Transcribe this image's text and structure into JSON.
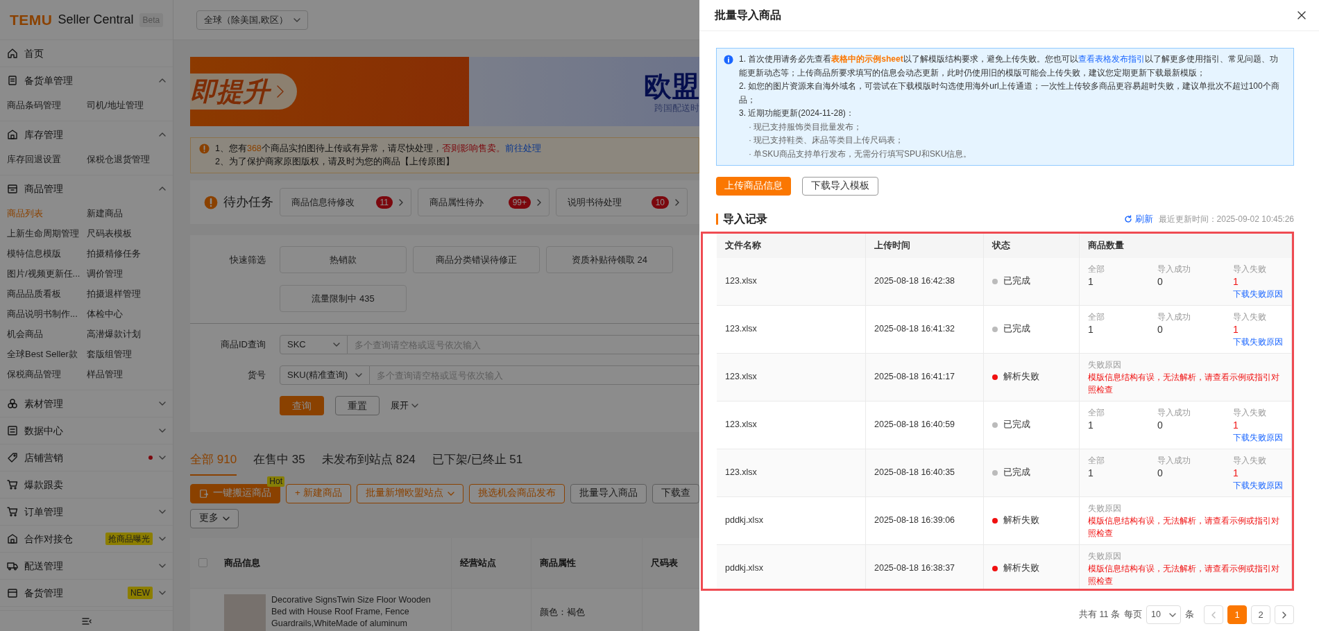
{
  "header": {
    "logo": "TEMU",
    "title": "Seller Central",
    "tag": "Beta",
    "region": "全球（除美国,欧区）"
  },
  "sidebar": {
    "items": [
      {
        "kind": "link",
        "label": "首页",
        "notice": false
      },
      {
        "kind": "group",
        "label": "备货单管理",
        "expanded": true,
        "notice": false,
        "children": [
          {
            "label": "商品条码管理",
            "selected": false
          },
          {
            "label": "司机/地址管理",
            "selected": false
          }
        ]
      },
      {
        "kind": "group",
        "label": "库存管理",
        "expanded": true,
        "notice": false,
        "children": [
          {
            "label": "库存回退设置",
            "selected": false
          },
          {
            "label": "保税仓退货管理",
            "selected": false
          }
        ]
      },
      {
        "kind": "group",
        "label": "商品管理",
        "expanded": true,
        "notice": false,
        "children": [
          {
            "label": "商品列表",
            "selected": true
          },
          {
            "label": "新建商品",
            "selected": false
          },
          {
            "label": "上新生命周期管理",
            "selected": false
          },
          {
            "label": "尺码表模板",
            "selected": false
          },
          {
            "label": "模特信息模版",
            "selected": false
          },
          {
            "label": "拍摄精修任务",
            "selected": false
          },
          {
            "label": "图片/视频更新任...",
            "selected": false
          },
          {
            "label": "调价管理",
            "selected": false
          },
          {
            "label": "商品品质看板",
            "selected": false
          },
          {
            "label": "拍摄退样管理",
            "selected": false
          },
          {
            "label": "商品说明书制作...",
            "selected": false
          },
          {
            "label": "体检中心",
            "selected": false
          },
          {
            "label": "机会商品",
            "selected": false
          },
          {
            "label": "高潜爆款计划",
            "selected": false
          },
          {
            "label": "全球Best Seller款",
            "selected": false
          },
          {
            "label": "套版组管理",
            "selected": false
          },
          {
            "label": "保税商品管理",
            "selected": false
          },
          {
            "label": "样品管理",
            "selected": false
          }
        ]
      },
      {
        "kind": "group",
        "label": "素材管理",
        "expanded": false,
        "notice": false
      },
      {
        "kind": "group",
        "label": "数据中心",
        "expanded": false,
        "notice": false
      },
      {
        "kind": "group",
        "label": "店铺营销",
        "expanded": false,
        "notice": true
      },
      {
        "kind": "link",
        "label": "爆款跟卖",
        "notice": false
      },
      {
        "kind": "group",
        "label": "订单管理",
        "expanded": false,
        "notice": false
      },
      {
        "kind": "group",
        "label": "合作对接仓",
        "expanded": false,
        "notice": false,
        "tag": "抢商品曝光"
      },
      {
        "kind": "group",
        "label": "配送管理",
        "expanded": false,
        "notice": false
      },
      {
        "kind": "group",
        "label": "备货管理",
        "expanded": false,
        "notice": false,
        "tag": "NEW"
      }
    ]
  },
  "main": {
    "banner": {
      "promo_text": "即提升",
      "eu_title": "欧盟",
      "eu_subtitle": "跨国配送时"
    },
    "notice": {
      "prefix": "1、您有",
      "count": "368",
      "middle": "个商品实拍图待上传或有异常，请尽快处理，",
      "warning": "否则影响售卖。",
      "link": "前往处理",
      "line2": "2、为了保护商家原图版权，请及时为您的商品【上传原图】"
    },
    "todo": {
      "title": "待办任务",
      "items": [
        {
          "label": "商品信息待修改",
          "count": "11"
        },
        {
          "label": "商品属性待办",
          "count": "99+"
        },
        {
          "label": "说明书待处理",
          "count": "10"
        }
      ]
    },
    "quick_filter": {
      "label": "快速筛选",
      "chips": [
        "热销款",
        "商品分类错误待修正",
        "资质补贴待领取 24",
        "流量限制中 435"
      ]
    },
    "search": {
      "fields": [
        {
          "label": "商品ID查询",
          "select": "SKC",
          "placeholder": "多个查询请空格或逗号依次输入"
        },
        {
          "label": "货号",
          "select": "SKU(精准查询)",
          "placeholder": "多个查询请空格或逗号依次输入"
        }
      ],
      "query_button": "查询",
      "reset_button": "重置",
      "expand_link": "展开"
    },
    "status_tabs": [
      {
        "label": "全部 910",
        "selected": true
      },
      {
        "label": "在售中 35",
        "selected": false
      },
      {
        "label": "未发布到站点 824",
        "selected": false
      },
      {
        "label": "已下架/已终止 51",
        "selected": false
      }
    ],
    "toolbar": {
      "buttons": [
        {
          "kind": "primary",
          "label": "一键搬运商品",
          "tag": "Hot"
        },
        {
          "kind": "accent",
          "label": "+ 新建商品"
        },
        {
          "kind": "accent-menu",
          "label": "批量新增欧盟站点"
        },
        {
          "kind": "accent",
          "label": "挑选机会商品发布"
        },
        {
          "kind": "plain",
          "label": "批量导入商品"
        },
        {
          "kind": "plain",
          "label": "下载查"
        }
      ],
      "more": "更多"
    },
    "product_table": {
      "select_all_checked": false,
      "columns": [
        "商品信息",
        "经营站点",
        "商品属性",
        "尺码表"
      ],
      "rows": [
        {
          "title": "Decorative SignsTwin Size Floor Wooden Bed with House Roof Frame, Fence Guardrails,WhiteMade of aluminum",
          "attribute": "颜色：褐色"
        }
      ]
    }
  },
  "drawer": {
    "title": "批量导入商品",
    "info": {
      "before": "1. 首次使用请务必先查看",
      "highlight": "表格中的示例sheet",
      "middle": "以了解模版结构要求，避免上传失败。您也可以",
      "link": "查看表格发布指引",
      "after": "以了解更多使用指引、常见问题、功能更新动态等；上传商品所要求填写的信息会动态更新，此时仍使用旧的模版可能会上传失败，建议您定期更新下载最新模版；",
      "lines": [
        "2. 如您的图片资源来自海外域名，可尝试在下载模版时勾选使用海外url上传通道；一次性上传较多商品更容易超时失败，建议单批次不超过100个商品；",
        "3. 近期功能更新(2024-11-28)："
      ],
      "bullets": [
        "· 现已支持服饰类目批量发布；",
        "· 现已支持鞋类、床品等类目上传尺码表；",
        "· 单SKU商品支持单行发布，无需分行填写SPU和SKU信息。"
      ]
    },
    "upload_button": "上传商品信息",
    "template_button": "下载导入模板",
    "records": {
      "title": "导入记录",
      "refresh": "刷新",
      "updated": "最近更新时间：2025-09-02 10:45:26",
      "columns": [
        "文件名称",
        "上传时间",
        "状态",
        "商品数量"
      ],
      "rows": [
        {
          "file": "123.xlsx",
          "time": "2025-08-18 16:42:38",
          "status": {
            "kind": "done",
            "label": "已完成"
          },
          "counts": [
            {
              "label": "全部",
              "value": "1"
            },
            {
              "label": "导入成功",
              "value": "0"
            },
            {
              "label": "导入失败",
              "value": "1",
              "link": "下载失败原因"
            }
          ]
        },
        {
          "file": "123.xlsx",
          "time": "2025-08-18 16:41:32",
          "status": {
            "kind": "done",
            "label": "已完成"
          },
          "counts": [
            {
              "label": "全部",
              "value": "1"
            },
            {
              "label": "导入成功",
              "value": "0"
            },
            {
              "label": "导入失败",
              "value": "1",
              "link": "下载失败原因"
            }
          ]
        },
        {
          "file": "123.xlsx",
          "time": "2025-08-18 16:41:17",
          "status": {
            "kind": "failed",
            "label": "解析失败"
          },
          "reason": {
            "label": "失败原因",
            "text": "模版信息结构有误，无法解析，请查看示例或指引对照检查"
          }
        },
        {
          "file": "123.xlsx",
          "time": "2025-08-18 16:40:59",
          "status": {
            "kind": "done",
            "label": "已完成"
          },
          "counts": [
            {
              "label": "全部",
              "value": "1"
            },
            {
              "label": "导入成功",
              "value": "0"
            },
            {
              "label": "导入失败",
              "value": "1",
              "link": "下载失败原因"
            }
          ]
        },
        {
          "file": "123.xlsx",
          "time": "2025-08-18 16:40:35",
          "status": {
            "kind": "done",
            "label": "已完成"
          },
          "counts": [
            {
              "label": "全部",
              "value": "1"
            },
            {
              "label": "导入成功",
              "value": "0"
            },
            {
              "label": "导入失败",
              "value": "1",
              "link": "下载失败原因"
            }
          ]
        },
        {
          "file": "pddkj.xlsx",
          "time": "2025-08-18 16:39:06",
          "status": {
            "kind": "failed",
            "label": "解析失败"
          },
          "reason": {
            "label": "失败原因",
            "text": "模版信息结构有误，无法解析，请查看示例或指引对照检查"
          }
        },
        {
          "file": "pddkj.xlsx",
          "time": "2025-08-18 16:38:37",
          "status": {
            "kind": "failed",
            "label": "解析失败"
          },
          "reason": {
            "label": "失败原因",
            "text": "模版信息结构有误，无法解析，请查看示例或指引对照检查"
          }
        }
      ]
    },
    "pagination": {
      "total": "共有 11 条",
      "per_page_label": "每页",
      "per_page": "10",
      "unit": "条",
      "pages": [
        {
          "label": "1",
          "selected": true
        },
        {
          "label": "2",
          "selected": false
        }
      ]
    }
  }
}
